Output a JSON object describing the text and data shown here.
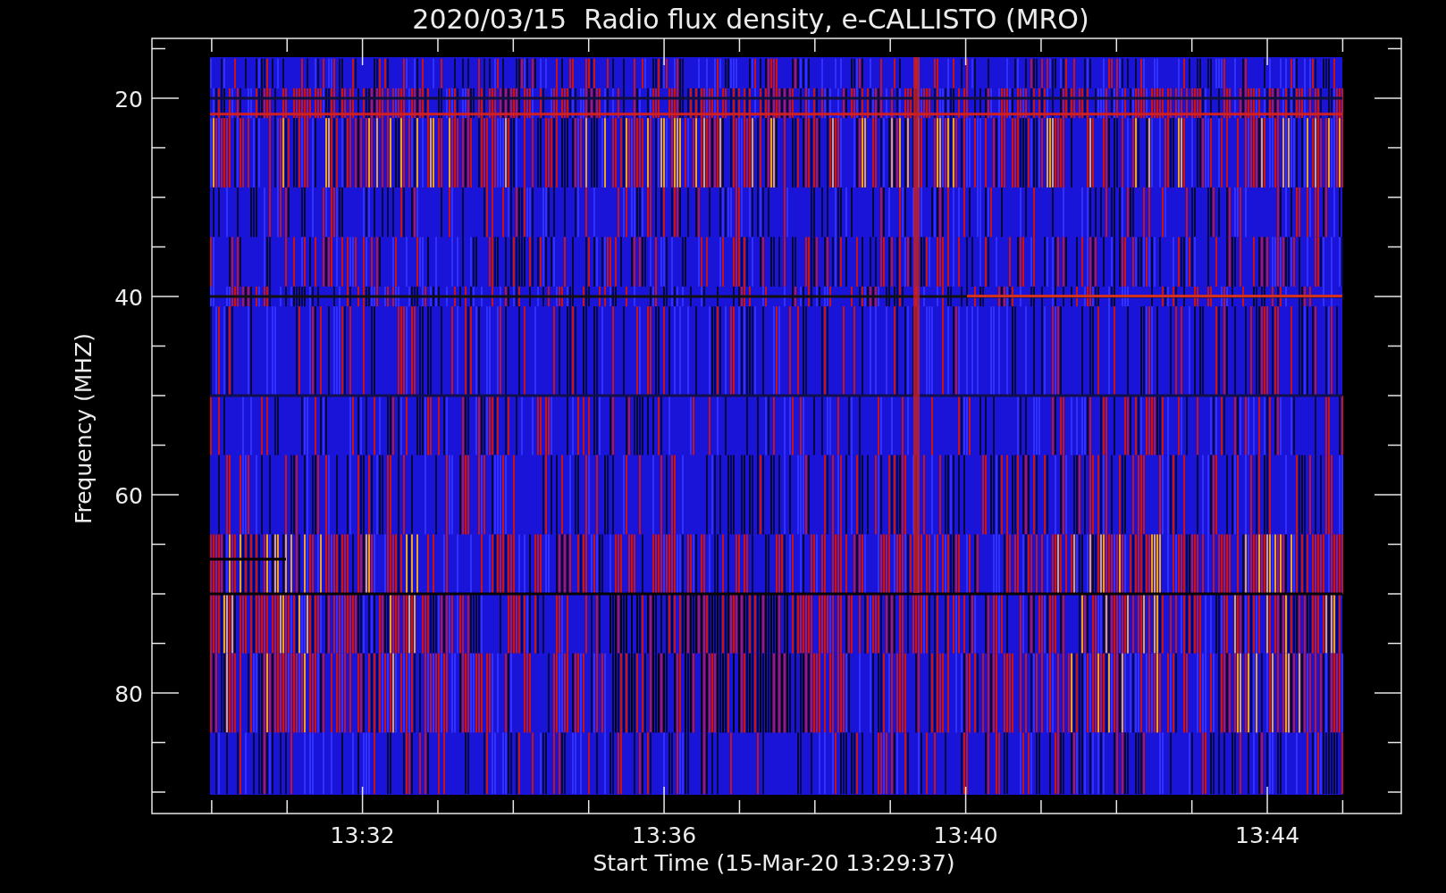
{
  "chart": {
    "title": "2020/03/15  Radio flux density, e-CALLISTO (MRO)",
    "ylabel": "Frequency (MHZ)",
    "xlabel": "Start Time (15-Mar-20 13:29:37)",
    "yticks": [
      "20",
      "40",
      "60",
      "80"
    ],
    "xticks": [
      "13:32",
      "13:36",
      "13:40",
      "13:44"
    ]
  }
}
